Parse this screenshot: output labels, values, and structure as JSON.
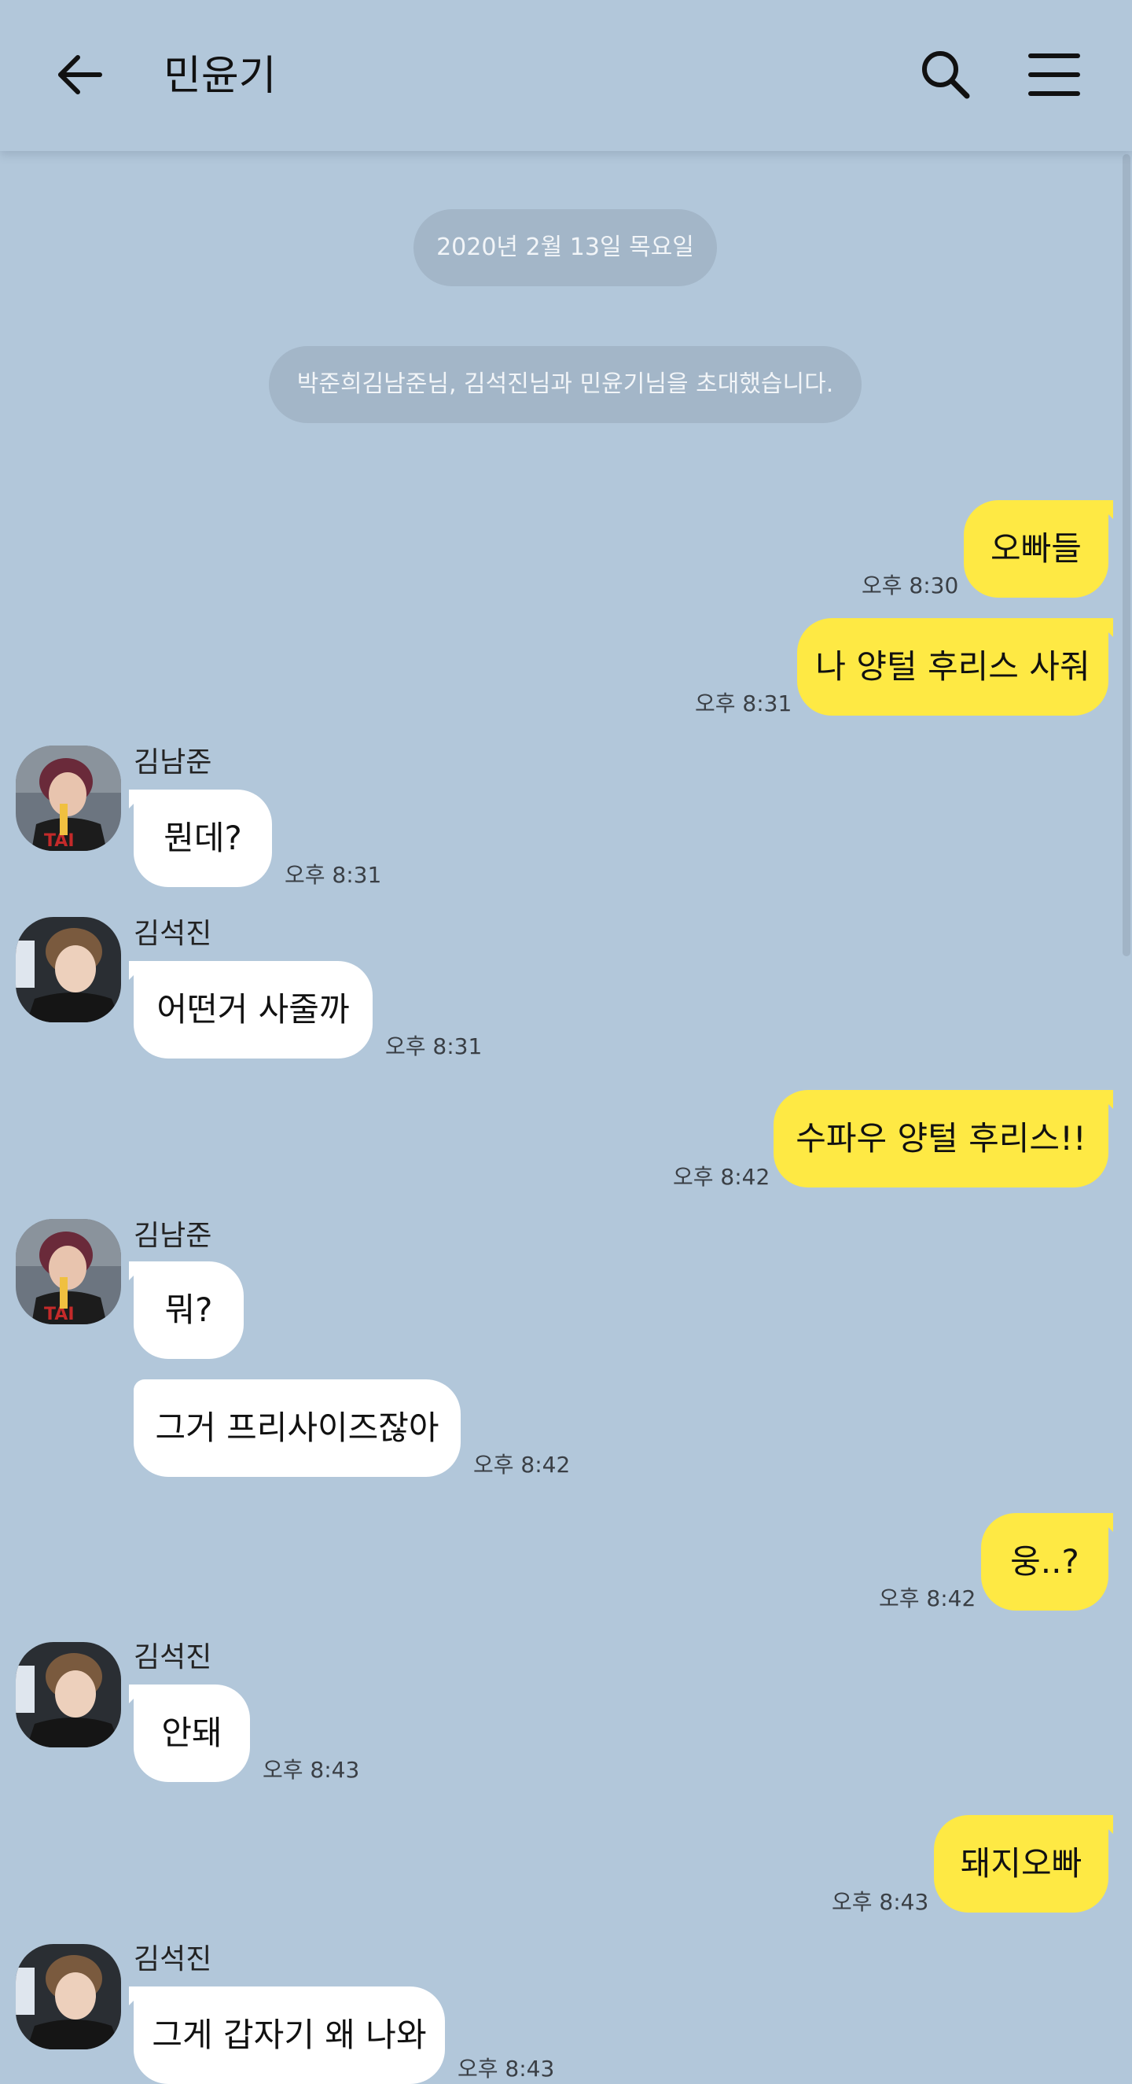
{
  "header": {
    "title": "민윤기",
    "back_icon": "arrow-left-icon",
    "search_icon": "search-icon",
    "menu_icon": "hamburger-menu-icon"
  },
  "notices": {
    "date": "2020년 2월 13일 목요일",
    "invite": "박준희김남준님, 김석진님과 민윤기님을 초대했습니다."
  },
  "messages": [
    {
      "sender": "me",
      "text": "오빠들",
      "time": "오후 8:30"
    },
    {
      "sender": "me",
      "text": "나 양털 후리스 사줘",
      "time": "오후 8:31"
    },
    {
      "sender": "김남준",
      "text": "뭔데?",
      "time": "오후 8:31"
    },
    {
      "sender": "김석진",
      "text": "어떤거 사줄까",
      "time": "오후 8:31"
    },
    {
      "sender": "me",
      "text": "수파우 양털 후리스!!",
      "time": "오후 8:42"
    },
    {
      "sender": "김남준",
      "text": "뭐?",
      "time": ""
    },
    {
      "sender": "김남준",
      "text": "그거 프리사이즈잖아",
      "time": "오후 8:42"
    },
    {
      "sender": "me",
      "text": "웅..?",
      "time": "오후 8:42"
    },
    {
      "sender": "김석진",
      "text": "안돼",
      "time": "오후 8:43"
    },
    {
      "sender": "me",
      "text": "돼지오빠",
      "time": "오후 8:43"
    },
    {
      "sender": "김석진",
      "text": "그게 갑자기 왜 나와",
      "time": "오후 8:43"
    }
  ],
  "colors": {
    "background": "#b2c7da",
    "my_bubble": "#fee944",
    "other_bubble": "#ffffff",
    "notice": "#a3b6c8"
  }
}
